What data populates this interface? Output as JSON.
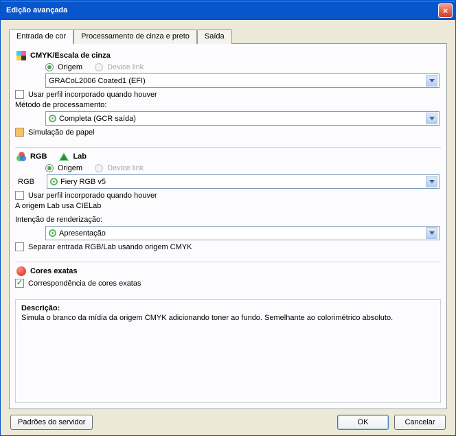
{
  "window": {
    "title": "Edição avançada"
  },
  "tabs": {
    "input": "Entrada de cor",
    "gray": "Processamento de cinza e preto",
    "output": "Saída"
  },
  "cmyk": {
    "heading": "CMYK/Escala de cinza",
    "source": "Origem",
    "deviceLink": "Device link",
    "profile": "GRACoL2006 Coated1 (EFI)",
    "useEmbedded": "Usar perfil incorporado quando houver",
    "methodLabel": "Método de processamento:",
    "method": "Completa (GCR saída)",
    "paperSim": "Simulação de papel"
  },
  "rgb": {
    "heading": "RGB",
    "labHeading": "Lab",
    "source": "Origem",
    "deviceLink": "Device link",
    "sideLabel": "RGB",
    "profile": "Fiery RGB v5",
    "useEmbedded": "Usar perfil incorporado quando houver",
    "labNote": "A origem Lab usa CIELab",
    "intentLabel": "Intenção de renderização:",
    "intent": "Apresentação",
    "separate": "Separar entrada RGB/Lab usando origem CMYK"
  },
  "spot": {
    "heading": "Cores exatas",
    "match": "Correspondência de cores exatas"
  },
  "description": {
    "title": "Descrição:",
    "body": "Simula o branco da mídia da origem CMYK adicionando toner ao fundo. Semelhante ao colorimétrico absoluto."
  },
  "footer": {
    "defaults": "Padrões do servidor",
    "ok": "OK",
    "cancel": "Cancelar"
  }
}
